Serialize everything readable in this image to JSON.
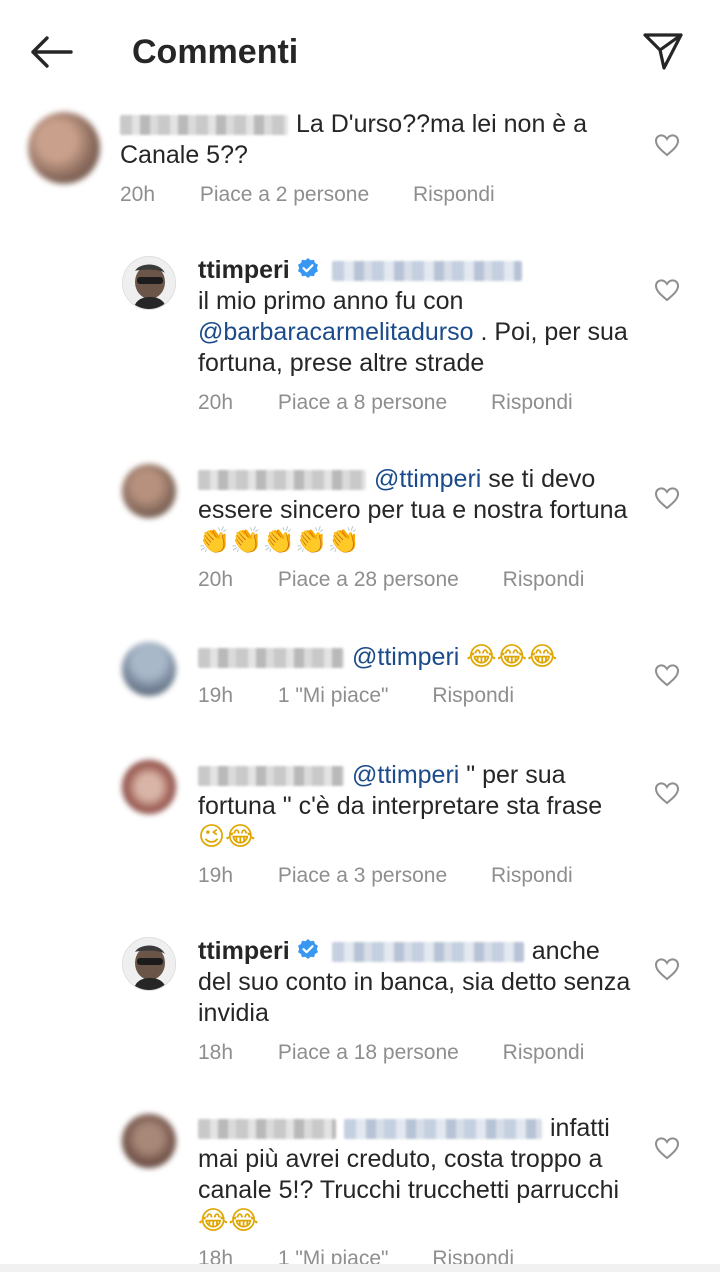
{
  "header": {
    "title": "Commenti",
    "back_icon": "arrow-left-icon",
    "send_icon": "send-icon"
  },
  "colors": {
    "mention": "#1b4b8a",
    "verified": "#3897f0",
    "meta": "#8e8e8e"
  },
  "comments": [
    {
      "username": "",
      "text": "La D'urso??ma lei non è  a Canale 5??",
      "time": "20h",
      "likes": "Piace a 2 persone",
      "reply": "Rispondi"
    },
    {
      "username": "ttimperi",
      "text_line1": "il mio primo anno fu con",
      "mention": "@barbaracarmelitadurso",
      "text_after": ". Poi, per sua fortuna, prese altre strade",
      "time": "20h",
      "likes": "Piace a 8 persone",
      "reply": "Rispondi"
    },
    {
      "username": "",
      "mention": "@ttimperi",
      "text": "se ti devo essere sincero  per tua e nostra fortuna",
      "emojis": "👏👏👏👏👏",
      "time": "20h",
      "likes": "Piace a 28 persone",
      "reply": "Rispondi"
    },
    {
      "username": "",
      "mention": "@ttimperi",
      "emojis": "😂😂😂",
      "time": "19h",
      "likes": "1 \"Mi piace\"",
      "reply": "Rispondi"
    },
    {
      "username": "",
      "mention": "@ttimperi",
      "text": "\" per sua fortuna \" c'è da interpretare sta frase",
      "emojis": "😉😂",
      "time": "19h",
      "likes": "Piace a 3 persone",
      "reply": "Rispondi"
    },
    {
      "username": "ttimperi",
      "text": "anche del suo conto in banca, sia detto senza invidia",
      "time": "18h",
      "likes": "Piace a 18 persone",
      "reply": "Rispondi"
    },
    {
      "username": "",
      "text": "infatti mai più avrei creduto, costa troppo a canale 5!? Trucchi trucchetti parrucchi",
      "emojis": "😂😂",
      "time": "18h",
      "likes": "1 \"Mi piace\"",
      "reply": "Rispondi"
    }
  ]
}
